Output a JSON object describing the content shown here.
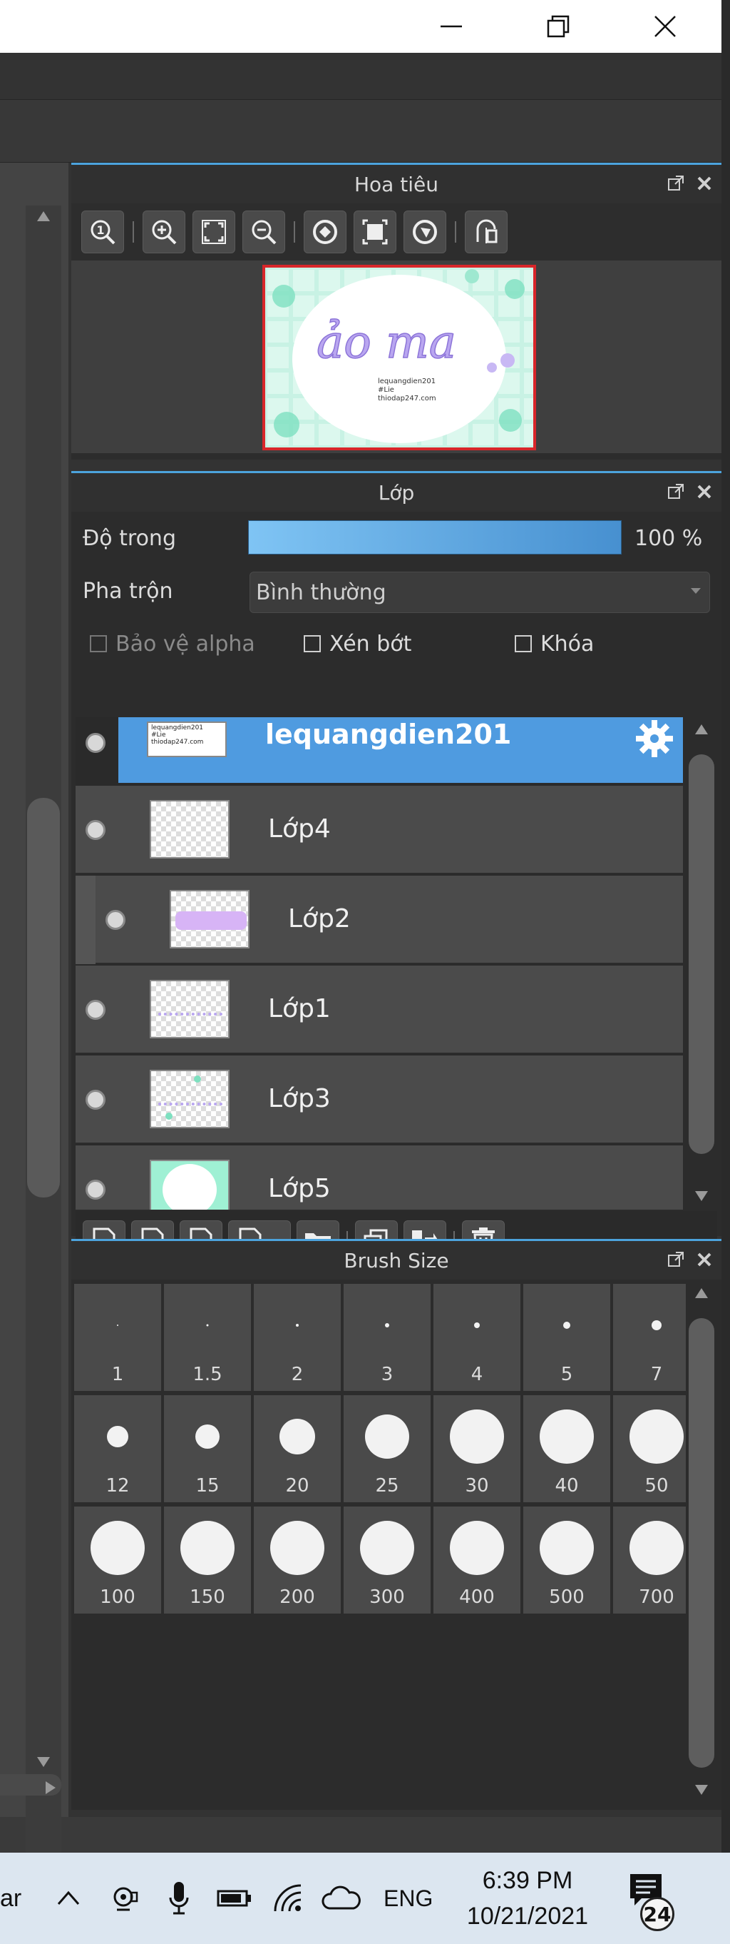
{
  "window": {
    "minimize_label": "—",
    "maximize_label": "❐",
    "close_label": "✕"
  },
  "navigator": {
    "title": "Hoa tiêu",
    "preview_text": {
      "title": "ảo ma",
      "lines": [
        "lequangdien201",
        "#Lie",
        "thiodap247.com"
      ]
    },
    "tools": [
      "zoom-actual-icon",
      "zoom-in-icon",
      "fit-screen-icon",
      "zoom-out-icon",
      "rotate-left-icon",
      "reset-view-icon",
      "rotate-right-icon",
      "flip-horizontal-icon"
    ]
  },
  "layers": {
    "title": "Lớp",
    "opacity_label": "Độ trong",
    "opacity_value": "100 %",
    "opacity_percent": 100,
    "blend_label": "Pha trộn",
    "blend_value": "Bình thường",
    "protect_alpha_label": "Bảo vệ alpha",
    "clip_label": "Xén bớt",
    "lock_label": "Khóa",
    "items": [
      {
        "name": "lequangdien201",
        "selected": true,
        "child": false,
        "thumb_text": [
          "lequangdien201",
          "#Lie",
          "thiodap247.com"
        ]
      },
      {
        "name": "Lớp4",
        "selected": false,
        "child": false
      },
      {
        "name": "Lớp2",
        "selected": false,
        "child": true
      },
      {
        "name": "Lớp1",
        "selected": false,
        "child": false
      },
      {
        "name": "Lớp3",
        "selected": false,
        "child": false
      },
      {
        "name": "Lớp5",
        "selected": false,
        "child": false
      }
    ]
  },
  "brush": {
    "title": "Brush Size",
    "sizes": [
      "1",
      "1.5",
      "2",
      "3",
      "4",
      "5",
      "7",
      "12",
      "15",
      "20",
      "25",
      "30",
      "40",
      "50",
      "100",
      "150",
      "200",
      "300",
      "400",
      "500",
      "700"
    ]
  },
  "taskbar": {
    "left_text": "ar",
    "language": "ENG",
    "time": "6:39 PM",
    "date": "10/21/2021",
    "notification_count": "24"
  },
  "colors": {
    "accent": "#4ca3dd",
    "selected_layer": "#4f9be0",
    "preview_border": "#d8262a",
    "panel_bg": "#2c2c2c"
  }
}
